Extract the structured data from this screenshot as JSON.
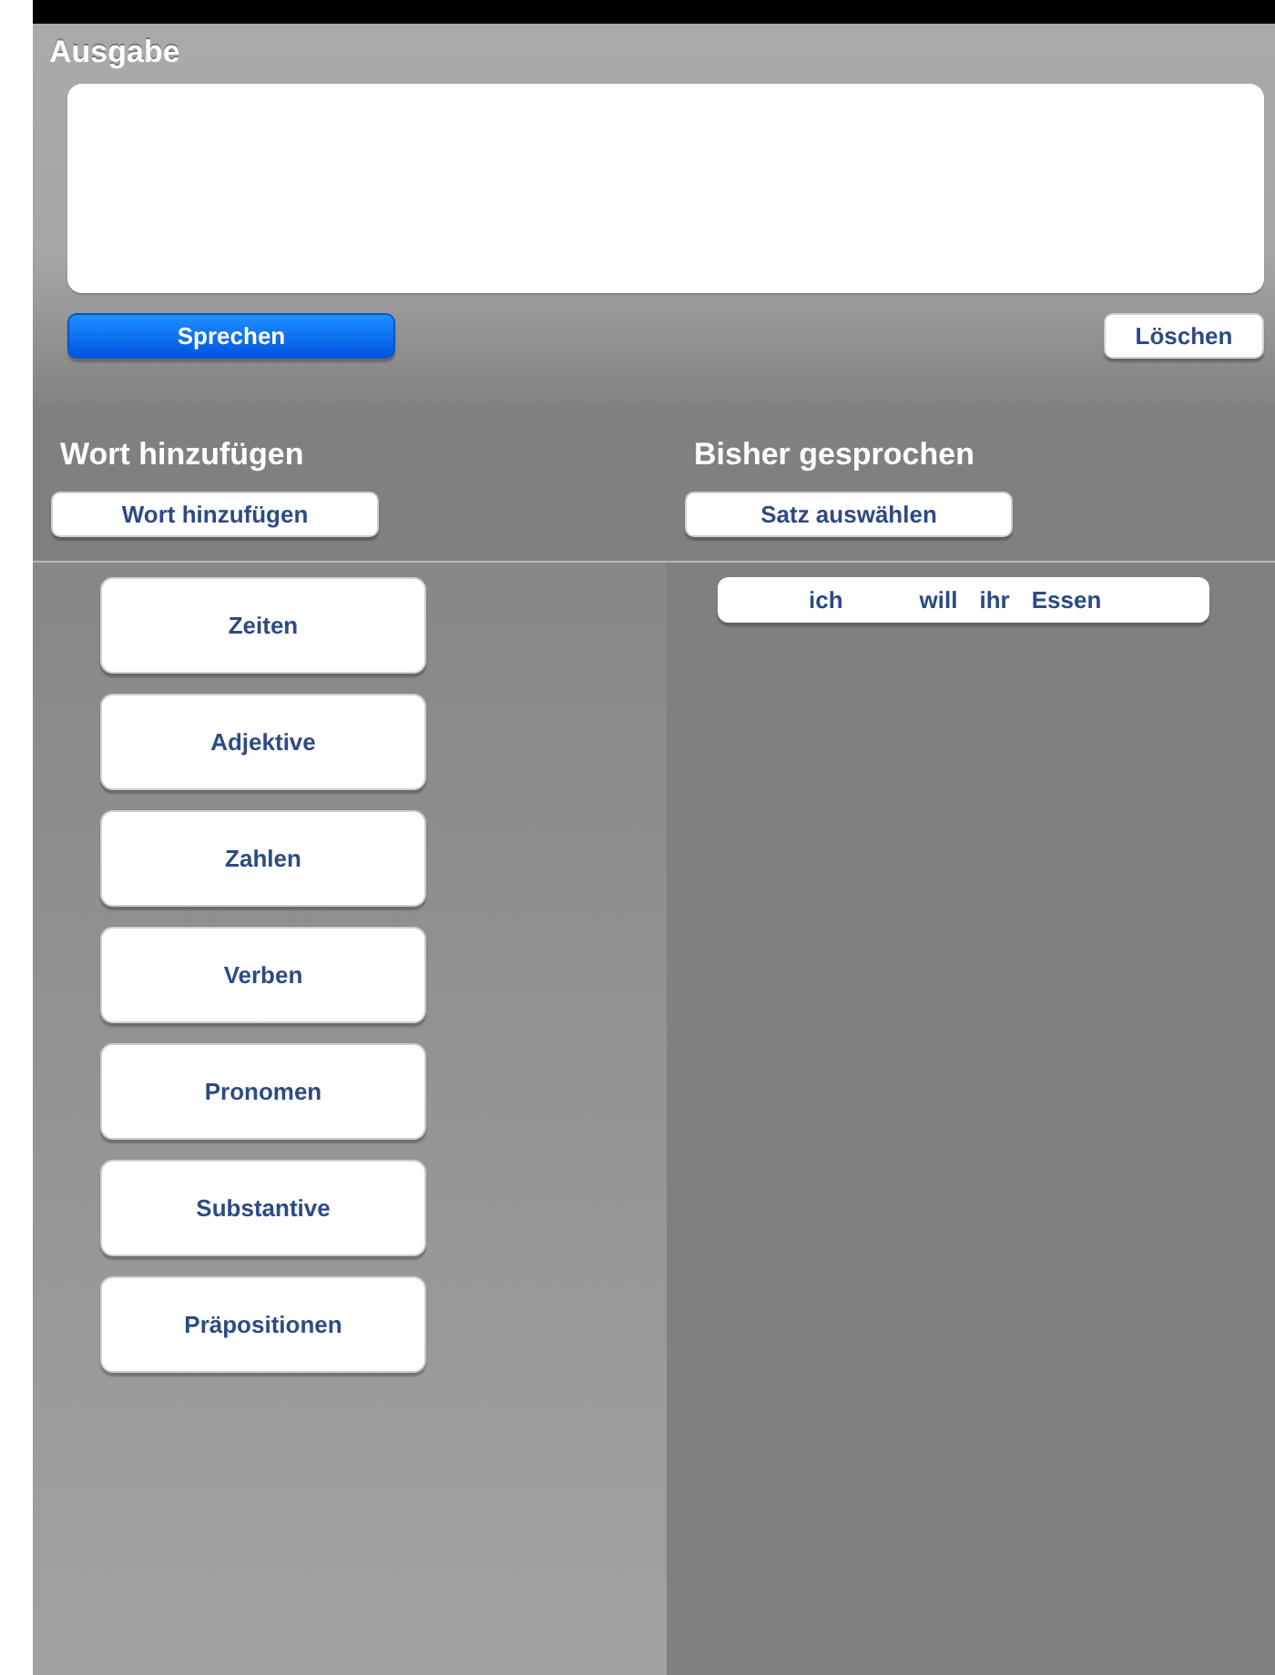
{
  "output": {
    "title": "Ausgabe"
  },
  "output_buttons": [
    {
      "kind": "primary",
      "label": "Sprechen"
    },
    {
      "kind": "plain",
      "label": "Löschen"
    }
  ],
  "add_word": {
    "title": "Wort hinzufügen",
    "button": "Wort hinzufügen",
    "categories": [
      "Zeiten",
      "Adjektive",
      "Zahlen",
      "Verben",
      "Pronomen",
      "Substantive",
      "Präpositionen"
    ]
  },
  "history": {
    "title": "Bisher gesprochen",
    "button": "Satz auswählen",
    "sentences": [
      {
        "words": [
          "ich",
          "will",
          "ihr",
          "Essen"
        ]
      }
    ]
  }
}
